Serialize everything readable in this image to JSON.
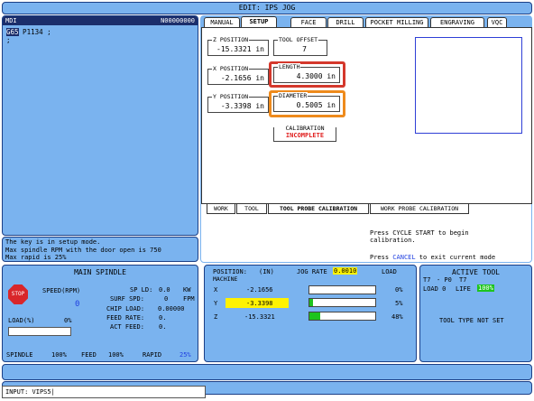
{
  "window": {
    "title": "EDIT: IPS JOG"
  },
  "mdi": {
    "header": "MDI",
    "program_no": "N00000000",
    "lines": [
      {
        "highlight": "G65",
        "text": " P1134 ;"
      },
      {
        "highlight": "",
        "text": ";"
      }
    ]
  },
  "message": {
    "lines": [
      "The key is in setup mode.",
      "Max spindle RPM with the door open is 750",
      "Max rapid is 25%"
    ]
  },
  "tabs": {
    "items": [
      "MANUAL",
      "SETUP",
      "FACE",
      "DRILL",
      "POCKET MILLING",
      "ENGRAVING",
      "VQC"
    ],
    "active": "SETUP"
  },
  "fields": {
    "z_position": {
      "label": "Z POSITION",
      "value": "-15.3321 in"
    },
    "tool_offset": {
      "label": "TOOL OFFSET",
      "value": "7"
    },
    "x_position": {
      "label": "X POSITION",
      "value": "-2.1656 in"
    },
    "length": {
      "label": "LENGTH",
      "value": "4.3000 in"
    },
    "y_position": {
      "label": "Y POSITION",
      "value": "-3.3398 in"
    },
    "diameter": {
      "label": "DIAMETER",
      "value": "0.5005 in"
    },
    "calibration": {
      "label": "CALIBRATION",
      "value": "INCOMPLETE"
    }
  },
  "subtabs": [
    "WORK",
    "TOOL",
    "TOOL PROBE CALIBRATION",
    "WORK PROBE CALIBRATION"
  ],
  "instructions": {
    "line1": "Press CYCLE START to begin",
    "line2": "calibration.",
    "cancel_pre": "Press ",
    "cancel_key": "CANCEL",
    "cancel_post": " to exit current mode"
  },
  "spindle": {
    "title": "MAIN SPINDLE",
    "stop_label": "STOP",
    "speed_label": "SPEED(RPM)",
    "speed_value": "0",
    "sp_ld_label": "SP LD:",
    "sp_ld_value": "0.0",
    "sp_ld_unit": "KW",
    "surf_spd_label": "SURF SPD:",
    "surf_spd_value": "0",
    "surf_spd_unit": "FPM",
    "chip_load_label": "CHIP LOAD:",
    "chip_load_value": "0.00000",
    "feed_rate_label": "FEED RATE:",
    "feed_rate_value": "0.",
    "act_feed_label": "ACT FEED:",
    "act_feed_value": "0.",
    "load_label": "LOAD(%)",
    "load_value": "0%",
    "spindle_label": "SPINDLE",
    "spindle_pct": "100%",
    "feed_label": "FEED",
    "feed_pct": "100%",
    "rapid_label": "RAPID",
    "rapid_pct": "25%"
  },
  "position": {
    "title": "POSITION:",
    "units": "(IN)",
    "sub": "MACHINE",
    "jog_rate_label": "JOG RATE",
    "jog_rate_value": "0.0010",
    "load_header": "LOAD",
    "axes": [
      {
        "axis": "X",
        "value": "-2.1656",
        "load": "0%",
        "fill": 0.0
      },
      {
        "axis": "Y",
        "value": "-3.3398",
        "load": "5%",
        "fill": 0.05
      },
      {
        "axis": "Z",
        "value": "-15.3321",
        "load": "48%",
        "fill": 0.17
      }
    ]
  },
  "active_tool": {
    "title": "ACTIVE TOOL",
    "t_left": "T7",
    "p_value": "- P0",
    "t_right": "T7",
    "load_label": "LOAD 0",
    "life_label": "LIFE",
    "life_value": "100%",
    "type": "TOOL TYPE NOT SET"
  },
  "input": {
    "label": "INPUT:",
    "value": "VIPS5"
  }
}
